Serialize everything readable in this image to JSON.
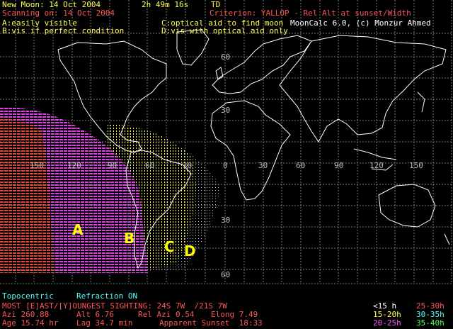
{
  "header": {
    "new_moon": "New Moon: 14 Oct 2004",
    "time": "2h 49m 16s",
    "time_type": "TD",
    "scanning": "Scanning on: 14 Oct 2004",
    "criterion": "Criterion: YALLOP - Rel Alt at sunset/Width",
    "app": "MoonCalc 6.0, (c) Monzur Ahmed",
    "legend_a": "A:easily visible",
    "legend_c": "C:optical aid to find moon",
    "legend_b": "B:vis if perfect condition",
    "legend_d": "D:vis with optical aid only"
  },
  "map": {
    "zone_labels": [
      "A",
      "B",
      "C",
      "D"
    ],
    "lon_labels": [
      "150",
      "120",
      "90",
      "60",
      "30",
      "0",
      "30",
      "60",
      "90",
      "120",
      "150"
    ],
    "lat_labels": [
      "60",
      "30",
      "30",
      "60"
    ]
  },
  "footer": {
    "topocentric": "Topocentric",
    "refraction": "Refraction ON",
    "most": "MOST [E]AST/[Y]OUNGEST SIGHTING: 24S 7W  /21S 7W",
    "azi": "Azi 260.88",
    "alt": "Alt 6.76",
    "rel_azi": "Rel Azi 0.54",
    "elong": "Elong 7.49",
    "age": "Age 15.74 hr",
    "lag": "Lag 34.7 min",
    "sunset": "Apparent Sunset  18:33"
  },
  "age_legend": [
    {
      "label": "<15 h",
      "color": "#ffffff"
    },
    {
      "label": "25-30h",
      "color": "#ff5555"
    },
    {
      "label": "15-20h",
      "color": "#ffff55"
    },
    {
      "label": "30-35h",
      "color": "#55ffff"
    },
    {
      "label": "20-25h",
      "color": "#ff55ff"
    },
    {
      "label": "35-40h",
      "color": "#55ff55"
    }
  ],
  "colors": {
    "header_yellow": "#ffff55",
    "header_red": "#ff5555",
    "header_white": "#ffffff",
    "footer_cyan": "#55ffff",
    "zone_a": "#ff5555",
    "zone_b": "#ff55ff",
    "zone_c": "#ffff55"
  }
}
